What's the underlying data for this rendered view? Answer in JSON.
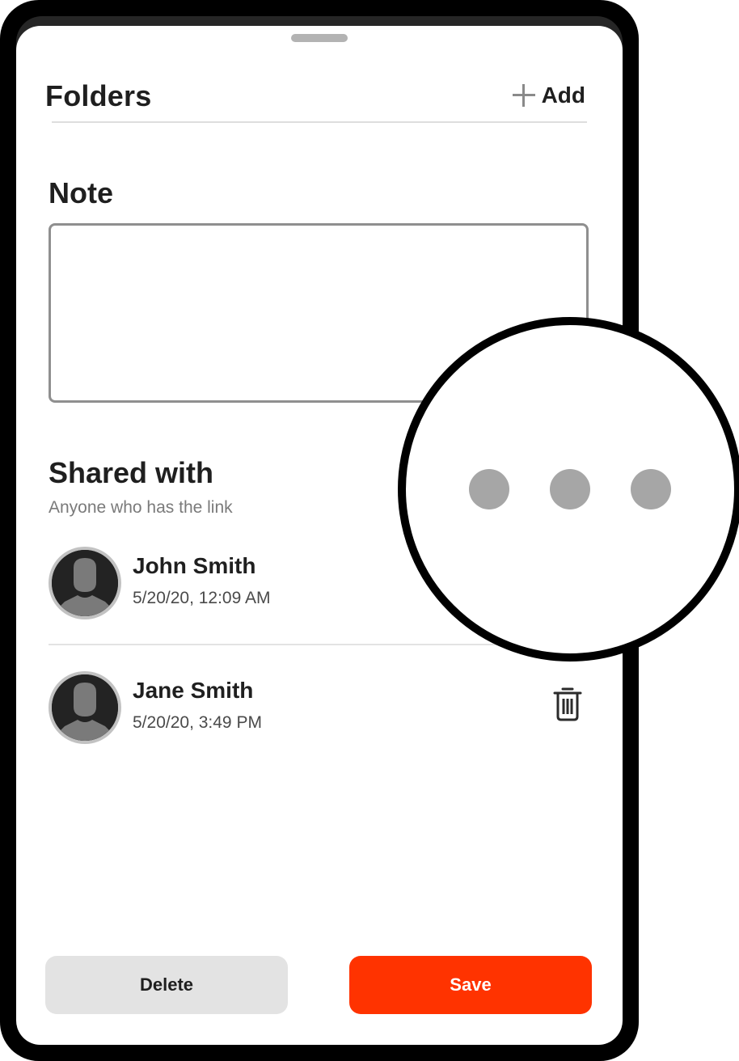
{
  "folders": {
    "title": "Folders",
    "add_label": "Add"
  },
  "note": {
    "title": "Note",
    "value": "",
    "placeholder": ""
  },
  "shared": {
    "title": "Shared with",
    "subtitle": "Anyone who has the link",
    "people": [
      {
        "name": "John Smith",
        "date": "5/20/20, 12:09 AM"
      },
      {
        "name": "Jane Smith",
        "date": "5/20/20, 3:49 PM"
      }
    ]
  },
  "actions": {
    "delete_label": "Delete",
    "save_label": "Save"
  },
  "icons": {
    "add": "plus-icon",
    "avatar": "user-avatar-icon",
    "delete_share": "trash-icon",
    "more": "more-horizontal-icon"
  },
  "colors": {
    "accent": "#ff3300",
    "secondary_button": "#e3e3e3",
    "dots": "#a6a6a6"
  }
}
